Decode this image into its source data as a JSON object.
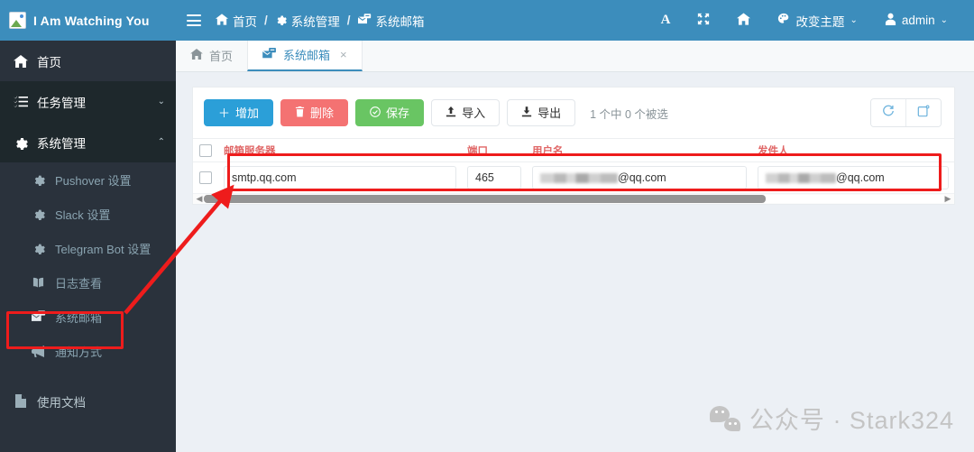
{
  "app": {
    "brand": "I Am Watching You",
    "logo_icon": "broken-image-icon",
    "accent_blue": "#3c8dbc",
    "sidebar_bg": "#2a323c",
    "annotation_red": "#ee1c1c"
  },
  "topbar": {
    "menu_toggle_icon": "hamburger-icon",
    "breadcrumb": [
      {
        "icon": "home-icon",
        "label": "首页"
      },
      {
        "icon": "gear-icon",
        "label": "系统管理"
      },
      {
        "icon": "mail-server-icon",
        "label": "系统邮箱"
      }
    ],
    "separator": "/",
    "actions": [
      {
        "name": "font-size-button",
        "icon": "letter-a-icon",
        "label": ""
      },
      {
        "name": "fullscreen-button",
        "icon": "expand-icon",
        "label": ""
      },
      {
        "name": "home-button",
        "icon": "home-icon",
        "label": ""
      },
      {
        "name": "theme-button",
        "icon": "palette-icon",
        "label": "改变主题",
        "caret": "⌄"
      },
      {
        "name": "user-menu",
        "icon": "user-icon",
        "label": "admin",
        "caret": "⌄"
      }
    ]
  },
  "sidebar": {
    "items": [
      {
        "icon": "home-icon",
        "label": "首页",
        "level": "top",
        "state": "normal",
        "arrow": ""
      },
      {
        "icon": "tasks-icon",
        "label": "任务管理",
        "level": "top",
        "state": "collapsed",
        "arrow": "⌄"
      },
      {
        "icon": "gear-icon",
        "label": "系统管理",
        "level": "top",
        "state": "expanded",
        "arrow": "⌃"
      },
      {
        "icon": "gear-icon",
        "label": "Pushover 设置",
        "level": "sub",
        "state": "normal",
        "arrow": ""
      },
      {
        "icon": "gear-icon",
        "label": "Slack 设置",
        "level": "sub",
        "state": "normal",
        "arrow": ""
      },
      {
        "icon": "gear-icon",
        "label": "Telegram Bot 设置",
        "level": "sub",
        "state": "normal",
        "arrow": ""
      },
      {
        "icon": "book-icon",
        "label": "日志查看",
        "level": "sub",
        "state": "normal",
        "arrow": ""
      },
      {
        "icon": "mail-server-icon",
        "label": "系统邮箱",
        "level": "sub",
        "state": "highlighted",
        "arrow": ""
      },
      {
        "icon": "megaphone-icon",
        "label": "通知方式",
        "level": "sub",
        "state": "normal",
        "arrow": ""
      },
      {
        "icon": "file-icon",
        "label": "使用文档",
        "level": "top",
        "state": "normal",
        "arrow": ""
      }
    ]
  },
  "tabs": [
    {
      "icon": "home-icon",
      "label": "首页",
      "active": false,
      "closable": false,
      "close": ""
    },
    {
      "icon": "mail-server-icon",
      "label": "系统邮箱",
      "active": true,
      "closable": true,
      "close": "×"
    }
  ],
  "toolbar": {
    "buttons": [
      {
        "name": "add-button",
        "icon": "plus-icon",
        "glyph": "＋",
        "label": "增加",
        "style": "primary"
      },
      {
        "name": "delete-button",
        "icon": "trash-icon",
        "glyph": "🗑",
        "label": "删除",
        "style": "danger"
      },
      {
        "name": "save-button",
        "icon": "check-circle-icon",
        "glyph": "⊘",
        "label": "保存",
        "style": "success"
      },
      {
        "name": "import-button",
        "icon": "upload-icon",
        "glyph": "⬆",
        "label": "导入",
        "style": "default"
      },
      {
        "name": "export-button",
        "icon": "download-icon",
        "glyph": "⬇",
        "label": "导出",
        "style": "default"
      }
    ],
    "selection_info": "1 个中 0 个被选",
    "right_buttons": [
      {
        "name": "refresh-button",
        "icon": "refresh-icon"
      },
      {
        "name": "column-toggle-button",
        "icon": "columns-icon"
      }
    ]
  },
  "table": {
    "select_all_checked": false,
    "columns": [
      {
        "key": "server",
        "label": "邮箱服务器"
      },
      {
        "key": "port",
        "label": "端口"
      },
      {
        "key": "username",
        "label": "用户名"
      },
      {
        "key": "sender",
        "label": "发件人"
      }
    ],
    "rows": [
      {
        "checked": false,
        "server": "smtp.qq.com",
        "port": "465",
        "username_masked": true,
        "username_suffix": "@qq.com",
        "sender_masked": true,
        "sender_suffix": "@qq.com"
      }
    ],
    "hscroll": {
      "left_arrow": "◀",
      "right_arrow": "▶",
      "thumb_percent": 76
    }
  },
  "annotations": {
    "sidebar_box_target": "系统邮箱",
    "row_box_target": "table-row",
    "arrow": "sidebar-to-table-arrow"
  },
  "watermark": {
    "icon": "wechat-icon",
    "text": "公众号 · Stark324"
  }
}
